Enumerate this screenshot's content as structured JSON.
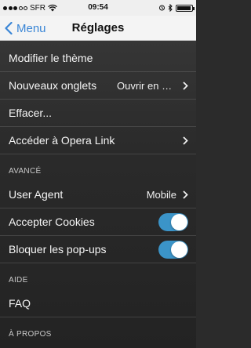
{
  "status_bar": {
    "carrier": "SFR",
    "time": "09:54"
  },
  "nav": {
    "back_label": "Menu",
    "title": "Réglages"
  },
  "settings": {
    "general": [
      {
        "label": "Modifier le thème"
      },
      {
        "label": "Nouveaux onglets",
        "value": "Ouvrir en arrière-plan"
      },
      {
        "label": "Effacer..."
      },
      {
        "label": "Accéder à Opera Link"
      }
    ],
    "advanced": {
      "header": "AVANCÉ",
      "user_agent": {
        "label": "User Agent",
        "value": "Mobile"
      },
      "accept_cookies": {
        "label": "Accepter Cookies",
        "on": true
      },
      "block_popups": {
        "label": "Bloquer les pop-ups",
        "on": true
      }
    },
    "help": {
      "header": "AIDE",
      "faq": {
        "label": "FAQ"
      }
    },
    "about": {
      "header": "À PROPOS"
    }
  },
  "colors": {
    "accent": "#3a86d6",
    "toggle_on": "#3b94c8"
  }
}
